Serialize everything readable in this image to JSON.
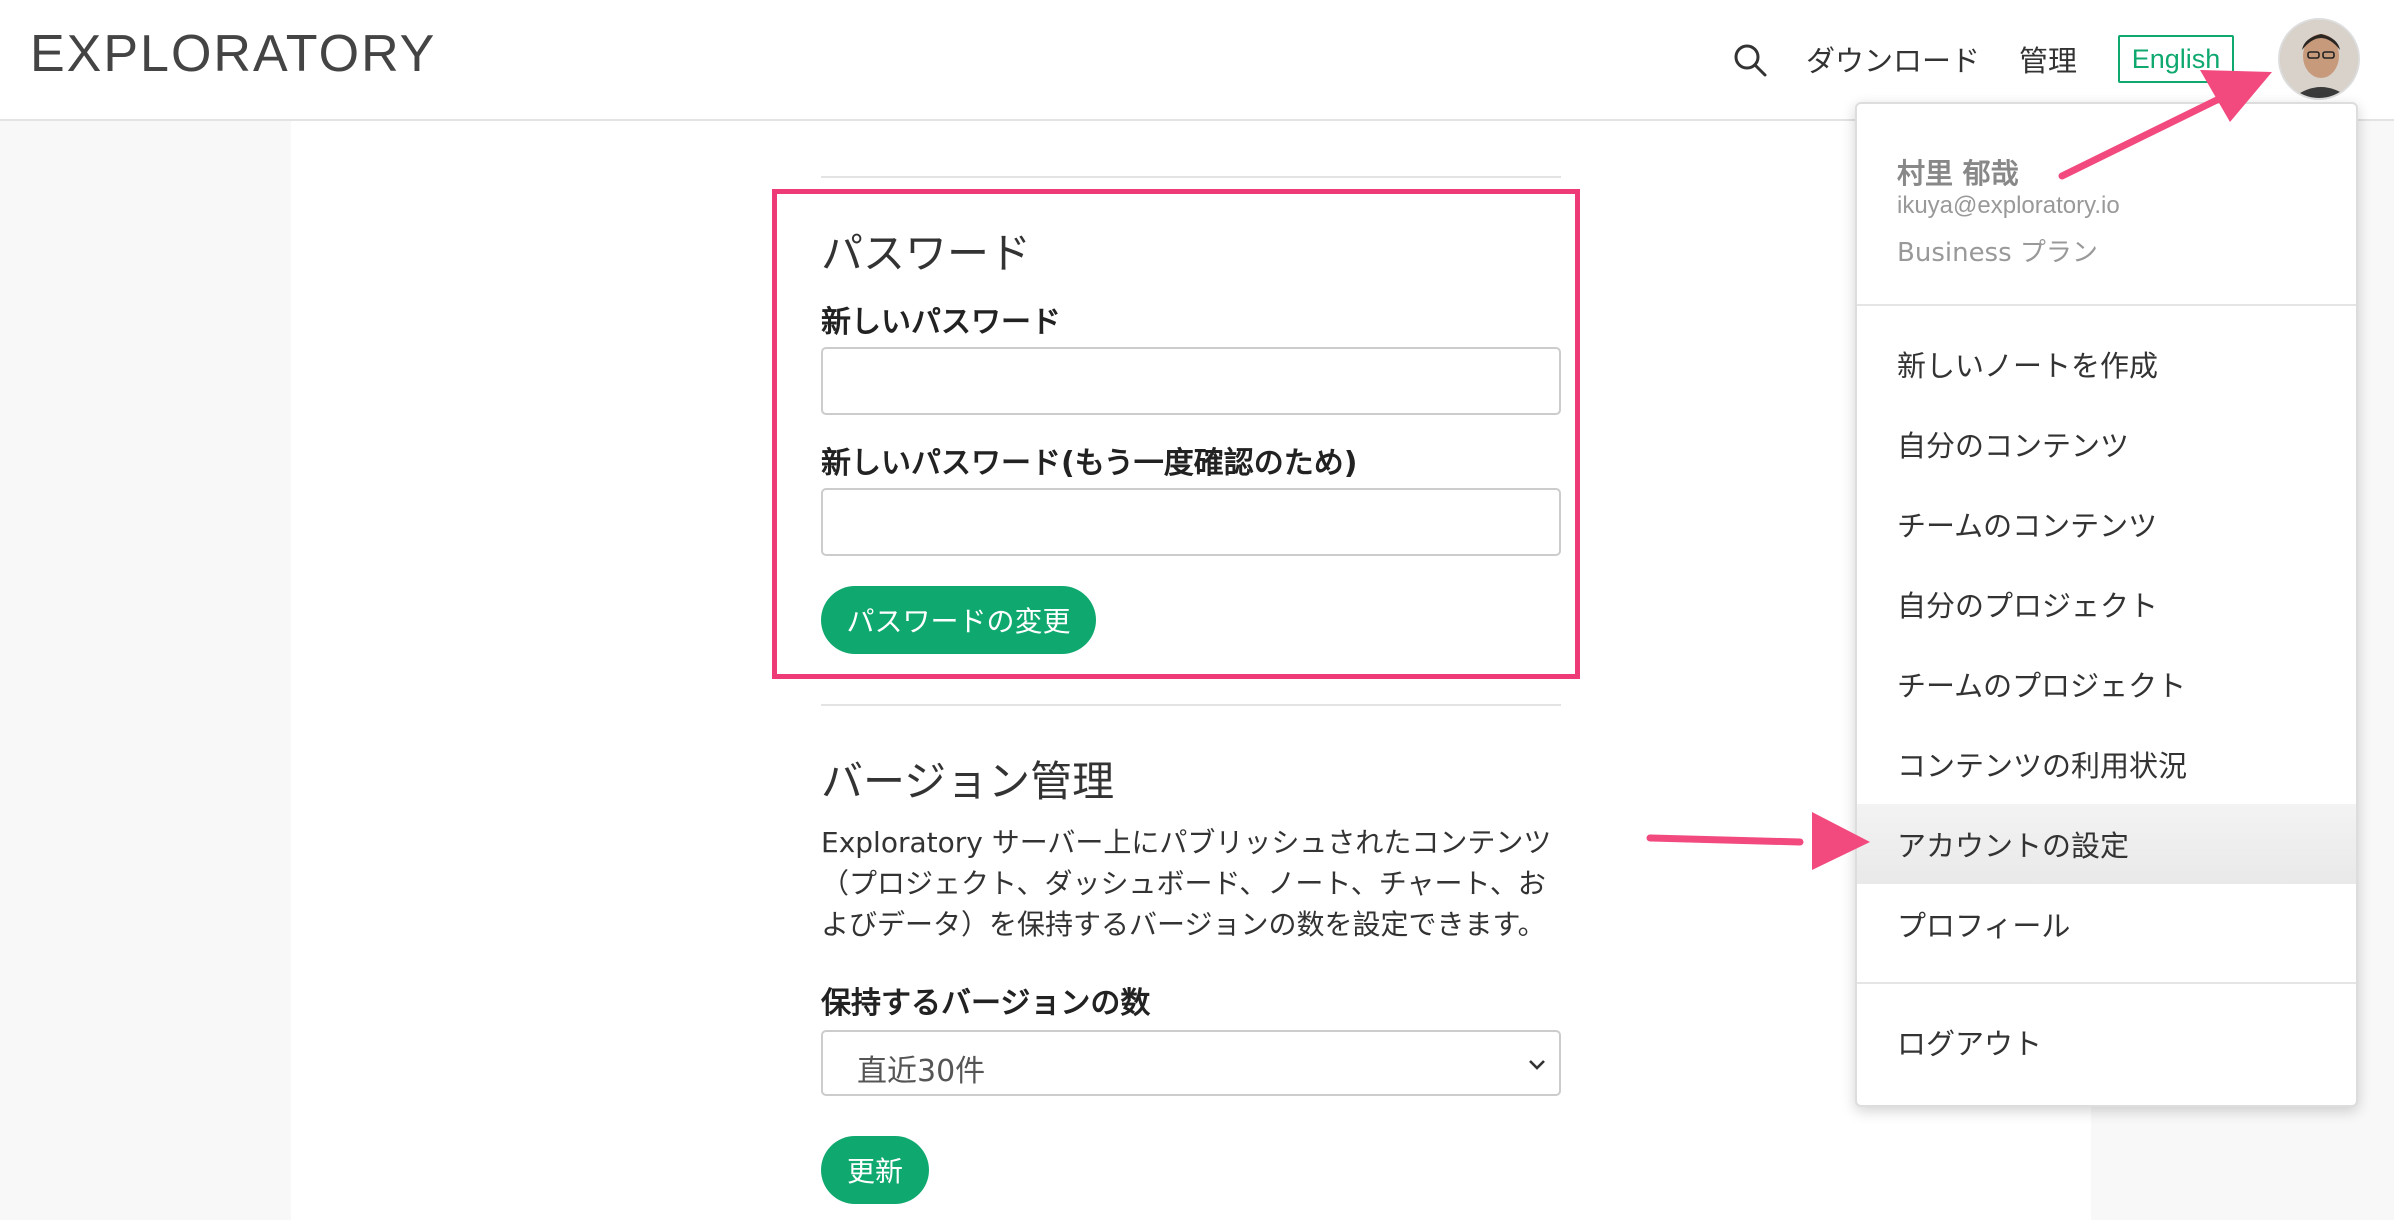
{
  "header": {
    "logo": "EXPLORATORY",
    "download_label": "ダウンロード",
    "admin_label": "管理",
    "language_label": "English"
  },
  "password_section": {
    "title": "パスワード",
    "new_password_label": "新しいパスワード",
    "confirm_password_label": "新しいパスワード(もう一度確認のため)",
    "new_password_value": "",
    "confirm_password_value": "",
    "change_button": "パスワードの変更"
  },
  "version_section": {
    "title": "バージョン管理",
    "description": "Exploratory サーバー上にパブリッシュされたコンテンツ（プロジェクト、ダッシュボード、ノート、チャート、およびデータ）を保持するバージョンの数を設定できます。",
    "keep_versions_label": "保持するバージョンの数",
    "keep_versions_value": "直近30件",
    "update_button": "更新"
  },
  "user_menu": {
    "name": "村里 郁哉",
    "email": "ikuya@exploratory.io",
    "plan": "Business プラン",
    "items": [
      {
        "label": "新しいノートを作成"
      },
      {
        "label": "自分のコンテンツ"
      },
      {
        "label": "チームのコンテンツ"
      },
      {
        "label": "自分のプロジェクト"
      },
      {
        "label": "チームのプロジェクト"
      },
      {
        "label": "コンテンツの利用状況"
      },
      {
        "label": "アカウントの設定"
      },
      {
        "label": "プロフィール"
      }
    ],
    "logout_label": "ログアウト",
    "active_item": "アカウントの設定"
  },
  "colors": {
    "brand_green": "#0fa970",
    "highlight_pink": "#ee3b78"
  },
  "icons": [
    "search-icon",
    "chevron-down-icon",
    "avatar"
  ]
}
